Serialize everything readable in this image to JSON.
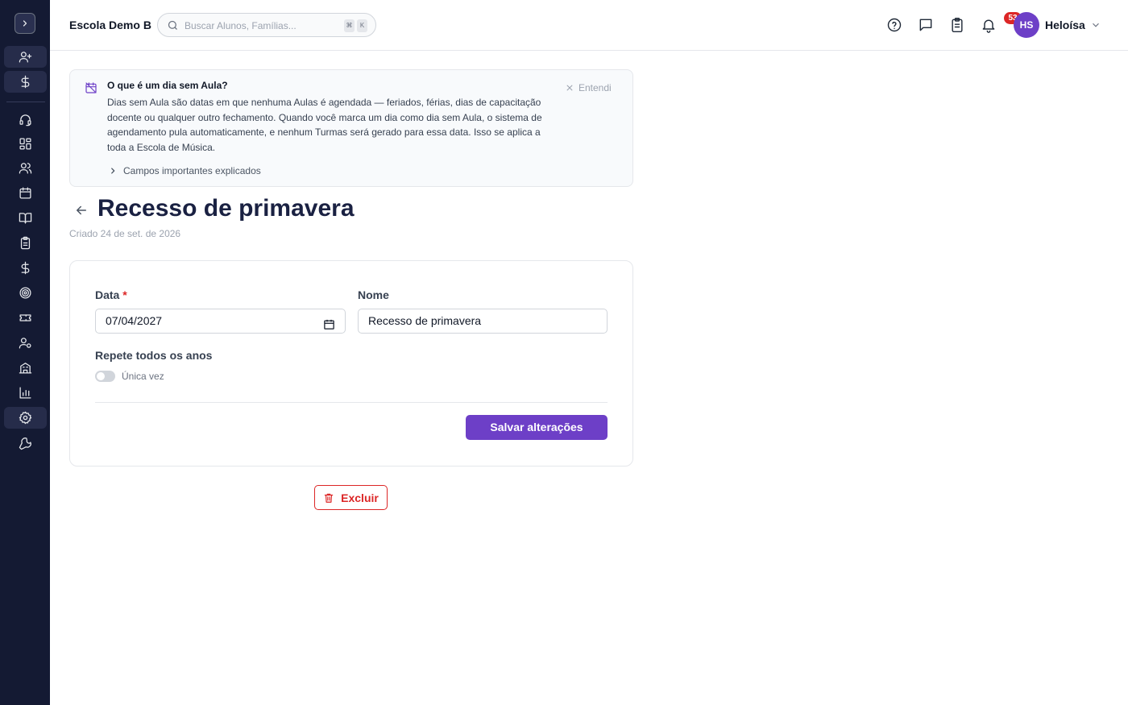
{
  "topbar": {
    "school_name": "Escola Demo B",
    "search_placeholder": "Buscar Alunos, Famílias...",
    "shortcut_keys": [
      "⌘",
      "K"
    ],
    "tasks_badge": "53",
    "avatar_initials": "HS",
    "user_name": "Heloísa",
    "icons": [
      "help-icon",
      "messages-icon",
      "tasks-icon",
      "bell-icon",
      "chevron-down-icon"
    ]
  },
  "sidebar": {
    "toggle_icon": "chevron-right-icon",
    "items": [
      {
        "icon": "user-plus-icon"
      },
      {
        "icon": "dollar-icon"
      },
      {
        "icon": "headset-icon"
      },
      {
        "icon": "dashboard-icon"
      },
      {
        "icon": "users-icon"
      },
      {
        "icon": "calendar-icon"
      },
      {
        "icon": "book-icon"
      },
      {
        "icon": "clipboard-icon"
      },
      {
        "icon": "dollar-icon"
      },
      {
        "icon": "target-icon"
      },
      {
        "icon": "ticket-icon"
      },
      {
        "icon": "user-settings-icon"
      },
      {
        "icon": "building-icon"
      },
      {
        "icon": "chart-icon"
      },
      {
        "icon": "settings-icon"
      },
      {
        "icon": "wrench-icon"
      }
    ]
  },
  "info_box": {
    "title": "O que é um dia sem Aula?",
    "body": "Dias sem Aula são datas em que nenhuma Aulas é agendada — feriados, férias, dias de capacitação docente ou qualquer outro fechamento. Quando você marca um dia como dia sem Aula, o sistema de agendamento pula automaticamente, e nenhum Turmas será gerado para essa data. Isso se aplica a toda a Escola de Música.",
    "dismiss_label": "Entendi",
    "expand_label": "Campos importantes explicados"
  },
  "page": {
    "title": "Recesso de primavera",
    "created": "Criado 24 de set. de 2026"
  },
  "form": {
    "date_label": "Data",
    "required_mark": "*",
    "date_value": "07/04/2027",
    "name_label": "Nome",
    "name_value": "Recesso de primavera",
    "repeat_label": "Repete todos os anos",
    "repeat_state": "Única vez",
    "repeat_enabled": false,
    "save_label": "Salvar alterações"
  },
  "delete_label": "Excluir",
  "colors": {
    "sidebar_bg": "#141a33",
    "accent": "#6d3fc7",
    "danger": "#dc2626",
    "title": "#1a2142"
  }
}
